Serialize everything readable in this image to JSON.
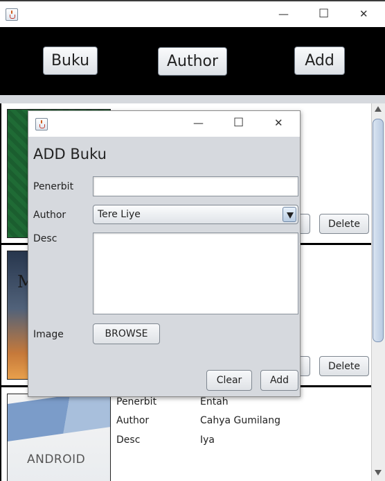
{
  "main_window": {
    "window_controls": {
      "minimize": "—",
      "maximize": "☐",
      "close": "✕"
    }
  },
  "nav": {
    "buku": "Buku",
    "author": "Author",
    "add": "Add"
  },
  "list": {
    "rows": [
      {
        "cover_icon": "book-cover-green",
        "edit_label": "",
        "delete_label": "Delete"
      },
      {
        "cover_icon": "book-cover-sunset",
        "cover_text": "M",
        "edit_label": "",
        "delete_label": "Delete"
      },
      {
        "cover_icon": "book-cover-android",
        "cover_text": "ANDROID",
        "penerbit_label": "Penerbit",
        "penerbit_value": "Entah",
        "author_label": "Author",
        "author_value": "Cahya Gumilang",
        "desc_label": "Desc",
        "desc_value": "Iya"
      }
    ]
  },
  "dialog": {
    "window_controls": {
      "minimize": "—",
      "maximize": "☐",
      "close": "✕"
    },
    "title": "ADD Buku",
    "penerbit_label": "Penerbit",
    "penerbit_value": "",
    "author_label": "Author",
    "author_selected": "Tere Liye",
    "desc_label": "Desc",
    "desc_value": "",
    "image_label": "Image",
    "browse_label": "BROWSE",
    "clear_label": "Clear",
    "add_label": "Add"
  },
  "colors": {
    "navbar": "#000000",
    "dialog_bg": "#d6d9de",
    "scroll_thumb": "#b9cbe2"
  }
}
